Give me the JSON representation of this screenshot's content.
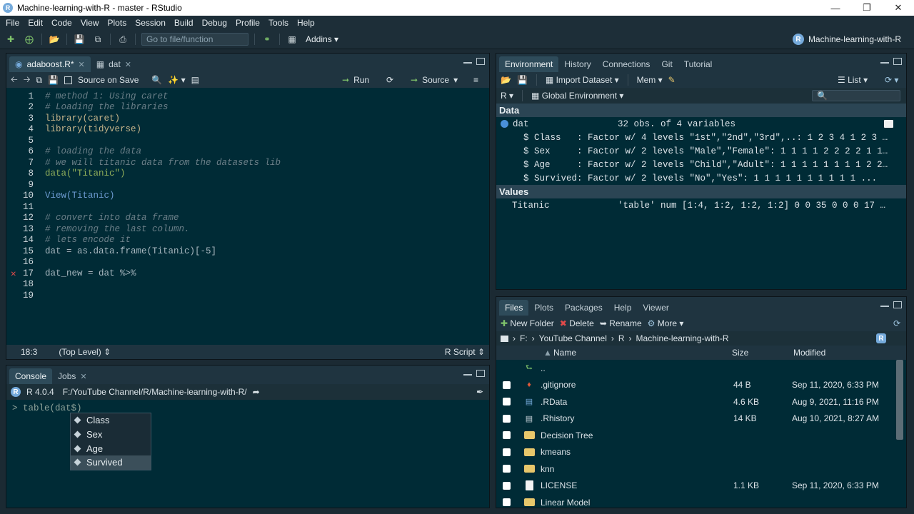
{
  "window": {
    "title": "Machine-learning-with-R - master - RStudio"
  },
  "menu": [
    "File",
    "Edit",
    "Code",
    "View",
    "Plots",
    "Session",
    "Build",
    "Debug",
    "Profile",
    "Tools",
    "Help"
  ],
  "toolbar": {
    "goto_placeholder": "Go to file/function",
    "addins": "Addins",
    "project": "Machine-learning-with-R"
  },
  "editor": {
    "tabs": [
      {
        "label": "adaboost.R*"
      },
      {
        "label": "dat"
      }
    ],
    "source_on_save": "Source on Save",
    "run": "Run",
    "source": "Source",
    "lines": [
      {
        "n": "1",
        "text": "# method 1: Using caret"
      },
      {
        "n": "2",
        "text": "# Loading the libraries"
      },
      {
        "n": "3",
        "text": "library(caret)"
      },
      {
        "n": "4",
        "text": "library(tidyverse)"
      },
      {
        "n": "5",
        "text": ""
      },
      {
        "n": "6",
        "text": "# loading the data"
      },
      {
        "n": "7",
        "text": "# we will titanic data from the datasets lib"
      },
      {
        "n": "8",
        "text": "data(\"Titanic\")"
      },
      {
        "n": "9",
        "text": ""
      },
      {
        "n": "10",
        "text": "View(Titanic)"
      },
      {
        "n": "11",
        "text": ""
      },
      {
        "n": "12",
        "text": "# convert into data frame"
      },
      {
        "n": "13",
        "text": "# removing the last column."
      },
      {
        "n": "14",
        "text": "# lets encode it"
      },
      {
        "n": "15",
        "text": "dat = as.data.frame(Titanic)[-5]"
      },
      {
        "n": "16",
        "text": ""
      },
      {
        "n": "17",
        "text": "dat_new = dat %>%"
      },
      {
        "n": "18",
        "text": ""
      },
      {
        "n": "19",
        "text": ""
      }
    ],
    "status": {
      "position": "18:3",
      "scope": "(Top Level)",
      "filetype": "R Script"
    }
  },
  "console": {
    "tabs": [
      {
        "label": "Console"
      },
      {
        "label": "Jobs"
      }
    ],
    "r_version": "R 4.0.4",
    "path": "F:/YouTube Channel/R/Machine-learning-with-R/",
    "prompt": ">",
    "input": "table(dat$)",
    "completions": [
      "Class",
      "Sex",
      "Age",
      "Survived"
    ]
  },
  "environment": {
    "tabs": [
      "Environment",
      "History",
      "Connections",
      "Git",
      "Tutorial"
    ],
    "import_dataset": "Import Dataset",
    "mem": "Mem",
    "list": "List",
    "lang": "R",
    "scope": "Global Environment",
    "data_header": "Data",
    "values_header": "Values",
    "dat_name": "dat",
    "dat_desc": "32 obs. of 4 variables",
    "dat_vars": [
      "$ Class   : Factor w/ 4 levels \"1st\",\"2nd\",\"3rd\",..: 1 2 3 4 1 2 3 …",
      "$ Sex     : Factor w/ 2 levels \"Male\",\"Female\": 1 1 1 1 2 2 2 2 1 1…",
      "$ Age     : Factor w/ 2 levels \"Child\",\"Adult\": 1 1 1 1 1 1 1 1 2 2…",
      "$ Survived: Factor w/ 2 levels \"No\",\"Yes\": 1 1 1 1 1 1 1 1 1 1 ..."
    ],
    "value_name": "Titanic",
    "value_desc": "'table' num [1:4, 1:2, 1:2, 1:2] 0 0 35 0 0 0 17 …"
  },
  "files": {
    "tabs": [
      "Files",
      "Plots",
      "Packages",
      "Help",
      "Viewer"
    ],
    "new_folder": "New Folder",
    "delete": "Delete",
    "rename": "Rename",
    "more": "More",
    "breadcrumb": [
      "F:",
      "YouTube Channel",
      "R",
      "Machine-learning-with-R"
    ],
    "columns": {
      "name": "Name",
      "size": "Size",
      "modified": "Modified"
    },
    "up": "..",
    "rows": [
      {
        "name": ".gitignore",
        "size": "44 B",
        "modified": "Sep 11, 2020, 6:33 PM",
        "icon": "gitignore-icon"
      },
      {
        "name": ".RData",
        "size": "4.6 KB",
        "modified": "Aug 9, 2021, 11:16 PM",
        "icon": "rdata-icon"
      },
      {
        "name": ".Rhistory",
        "size": "14 KB",
        "modified": "Aug 10, 2021, 8:27 AM",
        "icon": "rhistory-icon"
      },
      {
        "name": "Decision Tree",
        "size": "",
        "modified": "",
        "icon": "folder-icon"
      },
      {
        "name": "kmeans",
        "size": "",
        "modified": "",
        "icon": "folder-icon"
      },
      {
        "name": "knn",
        "size": "",
        "modified": "",
        "icon": "folder-icon"
      },
      {
        "name": "LICENSE",
        "size": "1.1 KB",
        "modified": "Sep 11, 2020, 6:33 PM",
        "icon": "file-icon"
      },
      {
        "name": "Linear Model",
        "size": "",
        "modified": "",
        "icon": "folder-icon"
      }
    ]
  }
}
